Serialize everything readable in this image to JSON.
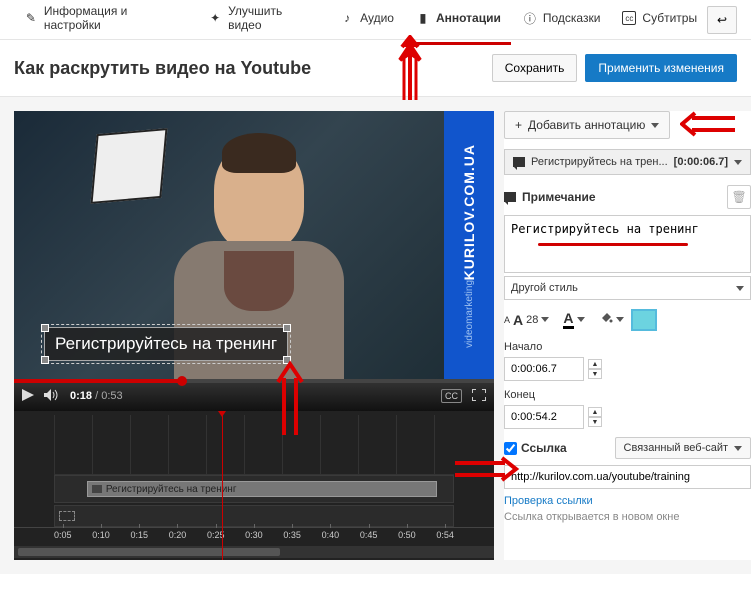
{
  "tabs": {
    "info": "Информация и настройки",
    "enhance": "Улучшить видео",
    "audio": "Аудио",
    "annotations": "Аннотации",
    "cards": "Подсказки",
    "subtitles": "Субтитры"
  },
  "header": {
    "title": "Как раскрутить видео на Youtube",
    "save": "Сохранить",
    "apply": "Применить изменения"
  },
  "player": {
    "annotation_text": "Регистрируйтесь на тренинг",
    "banner_main": "KURILOV.COM.UA",
    "banner_sub": "videomarketing",
    "time_current": "0:18",
    "time_total": "0:53"
  },
  "timeline": {
    "clip_label": "Регистрируйтесь на тренинг",
    "ticks": {
      "t0": "0:05",
      "t1": "0:10",
      "t2": "0:15",
      "t3": "0:20",
      "t4": "0:25",
      "t5": "0:30",
      "t6": "0:35",
      "t7": "0:40",
      "t8": "0:45",
      "t9": "0:50",
      "t10": "0:54"
    }
  },
  "side": {
    "add_annotation": "Добавить аннотацию",
    "entry_text": "Регистрируйтесь на трен...",
    "entry_time": "[0:00:06.7]",
    "section_note": "Примечание",
    "textarea_value": "Регистрируйтесь на тренинг",
    "style": "Другой стиль",
    "fontsize": "28",
    "start_label": "Начало",
    "start_value": "0:00:06.7",
    "end_label": "Конец",
    "end_value": "0:00:54.2",
    "link_label": "Ссылка",
    "link_type": "Связанный веб-сайт",
    "url": "http://kurilov.com.ua/youtube/training",
    "link_check": "Проверка ссылки",
    "link_hint": "Ссылка открывается в новом окне"
  }
}
